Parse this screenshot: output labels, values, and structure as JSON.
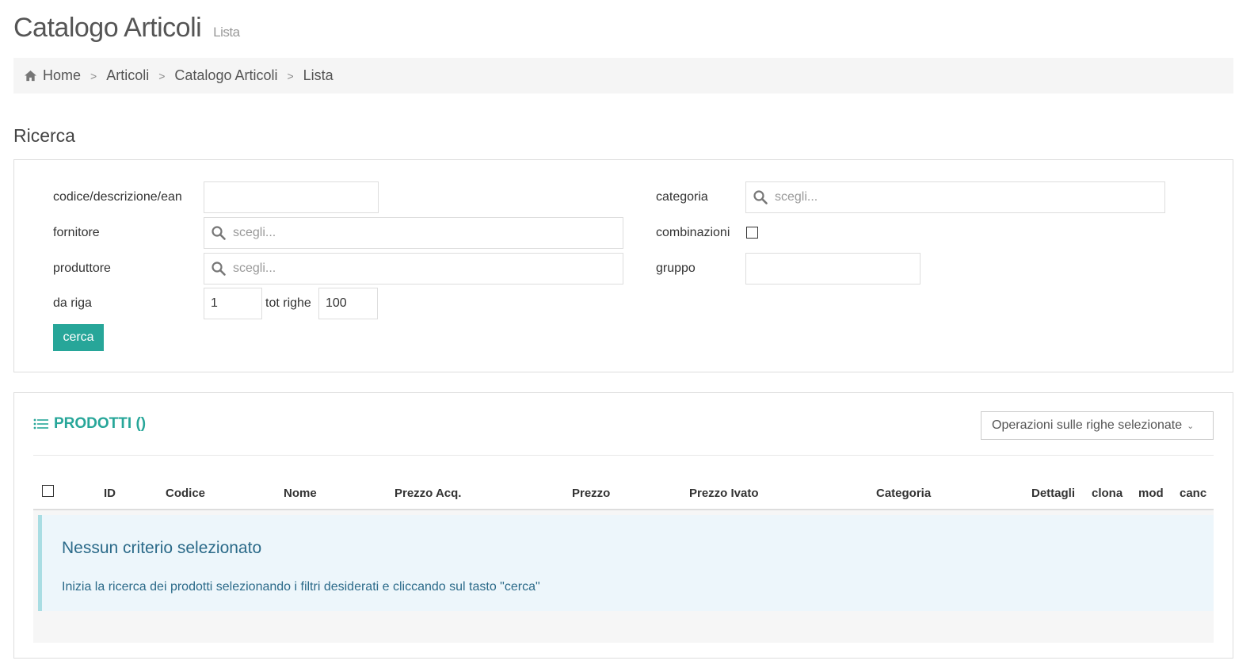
{
  "header": {
    "title": "Catalogo Articoli",
    "subtitle": "Lista"
  },
  "breadcrumb": {
    "items": [
      "Home",
      "Articoli",
      "Catalogo Articoli",
      "Lista"
    ],
    "separator": ">"
  },
  "search": {
    "section_title": "Ricerca",
    "fields": {
      "codice": {
        "label": "codice/descrizione/ean",
        "value": ""
      },
      "fornitore": {
        "label": "fornitore",
        "placeholder": "scegli..."
      },
      "produttore": {
        "label": "produttore",
        "placeholder": "scegli..."
      },
      "da_riga": {
        "label": "da riga",
        "value": "1"
      },
      "tot_righe": {
        "label": "tot righe",
        "value": "100"
      },
      "categoria": {
        "label": "categoria",
        "placeholder": "scegli..."
      },
      "combinazioni": {
        "label": "combinazioni",
        "checked": false
      },
      "gruppo": {
        "label": "gruppo",
        "value": ""
      }
    },
    "button_label": "cerca"
  },
  "products": {
    "title": "PRODOTTI ()",
    "operations_label": "Operazioni sulle righe selezionate",
    "columns": [
      "ID",
      "Codice",
      "Nome",
      "Prezzo Acq.",
      "Prezzo",
      "Prezzo Ivato",
      "Categoria",
      "Dettagli",
      "clona",
      "mod",
      "canc"
    ],
    "empty": {
      "title": "Nessun criterio selezionato",
      "text": "Inizia la ricerca dei prodotti selezionando i filtri desiderati e cliccando sul tasto \"cerca\""
    }
  },
  "colors": {
    "accent": "#27a699",
    "alert_bg": "#edf6fb",
    "alert_text": "#2b6a89"
  }
}
